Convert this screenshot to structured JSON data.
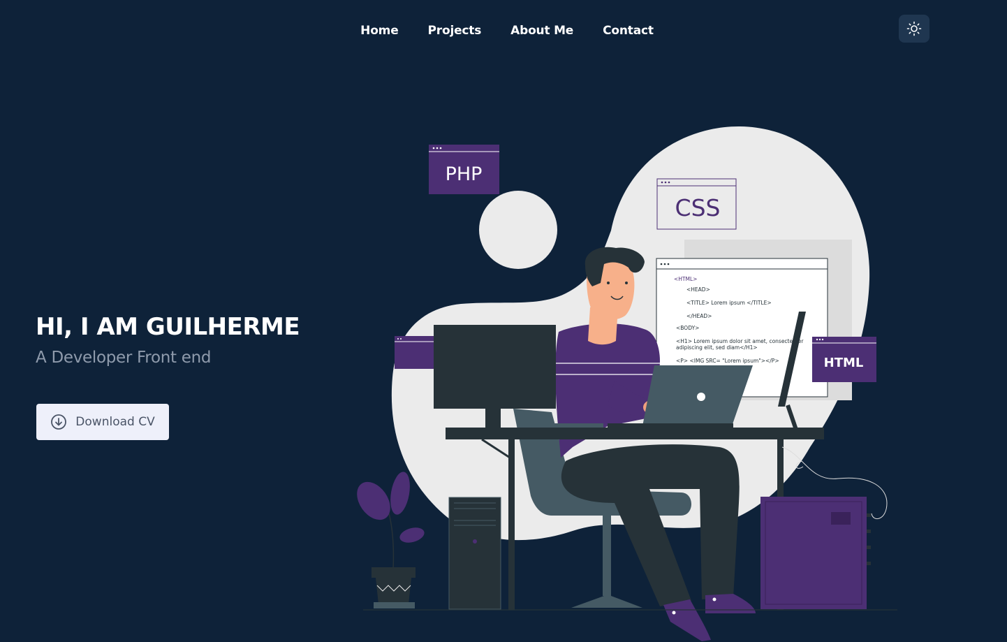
{
  "nav": {
    "items": [
      {
        "label": "Home"
      },
      {
        "label": "Projects"
      },
      {
        "label": "About Me"
      },
      {
        "label": "Contact"
      }
    ],
    "theme_toggle_icon": "sun-icon"
  },
  "hero": {
    "title": "HI, I AM GUILHERME",
    "subtitle": "A Developer Front end",
    "cta_label": "Download CV",
    "cta_icon": "download-circle-icon"
  },
  "illustration": {
    "php_label": "PHP",
    "css_label": "CSS",
    "html_label": "HTML",
    "code_lines": [
      "<HTML>",
      "<HEAD>",
      "<TITLE> Lorem ipsum </TITLE>",
      "</HEAD>",
      "<BODY>",
      "<H1> Lorem ipsum dolor sit amet, consectetuer",
      "adipiscing elit, sed diam</H1>",
      "<P> <IMG SRC= \"Lorem ipsum\"></P>"
    ]
  },
  "colors": {
    "background": "#0e2239",
    "accent_purple": "#4c2f74",
    "blob": "#ebebeb",
    "dark": "#263238"
  }
}
